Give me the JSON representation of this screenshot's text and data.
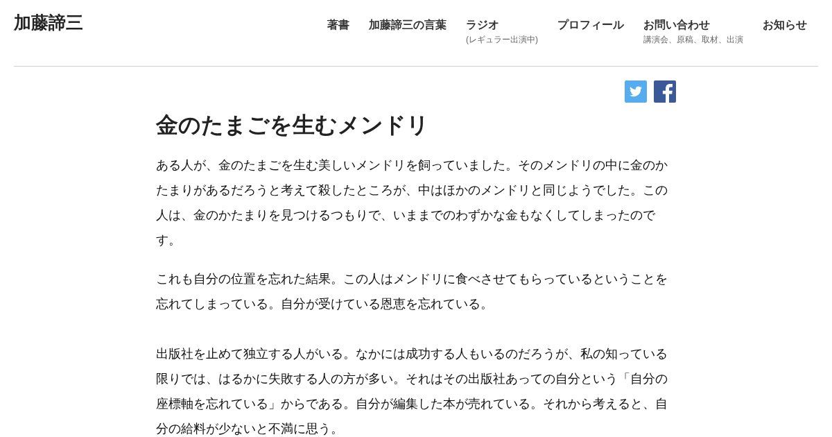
{
  "site_title": "加藤諦三",
  "nav": [
    {
      "label": "著書"
    },
    {
      "label": "加藤諦三の言葉"
    },
    {
      "label": "ラジオ",
      "sublabel": "(レギュラー出演中)"
    },
    {
      "label": "プロフィール"
    },
    {
      "label": "お問い合わせ",
      "sublabel": "講演会、原稿、取材、出演"
    },
    {
      "label": "お知らせ"
    }
  ],
  "article": {
    "title": "金のたまごを生むメンドリ",
    "sections": [
      {
        "paragraphs": [
          "ある人が、金のたまごを生む美しいメンドリを飼っていました。そのメンドリの中に金のかたまりがあるだろうと考えて殺したところが、中はほかのメンドリと同じようでした。この人は、金のかたまりを見つけるつもりで、いままでのわずかな金もなくしてしまったのです。",
          "これも自分の位置を忘れた結果。この人はメンドリに食べさせてもらっているということを忘れてしまっている。自分が受けている恩恵を忘れている。"
        ]
      },
      {
        "paragraphs": [
          "出版社を止めて独立する人がいる。なかには成功する人もいるのだろうが、私の知っている限りでは、はるかに失敗する人の方が多い。それはその出版社あっての自分という「自分の座標軸を忘れている」からである。自分が編集した本が売れている。それから考えると、自分の給料が少ないと不満に思う。"
        ]
      }
    ]
  }
}
